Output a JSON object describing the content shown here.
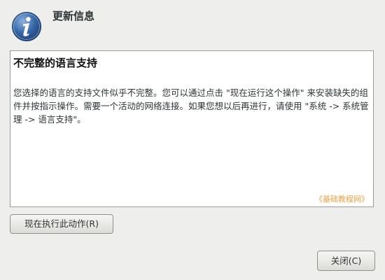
{
  "dialog": {
    "title": "更新信息",
    "icon": "info-icon",
    "accent_color": "#3465a4"
  },
  "message": {
    "heading": "不完整的语言支持",
    "body": "您选择的语言的支持文件似乎不完整。您可以通过点击 \"现在运行这个操作\" 来安装缺失的组件并按指示操作。需要一个活动的网络连接。如果您想以后再进行，请使用 \"系统 -> 系统管理 -> 语言支持\"。",
    "watermark": "《基础教程网》"
  },
  "buttons": {
    "run_action_label": "现在执行此动作(R)",
    "close_label": "关闭(C)"
  }
}
